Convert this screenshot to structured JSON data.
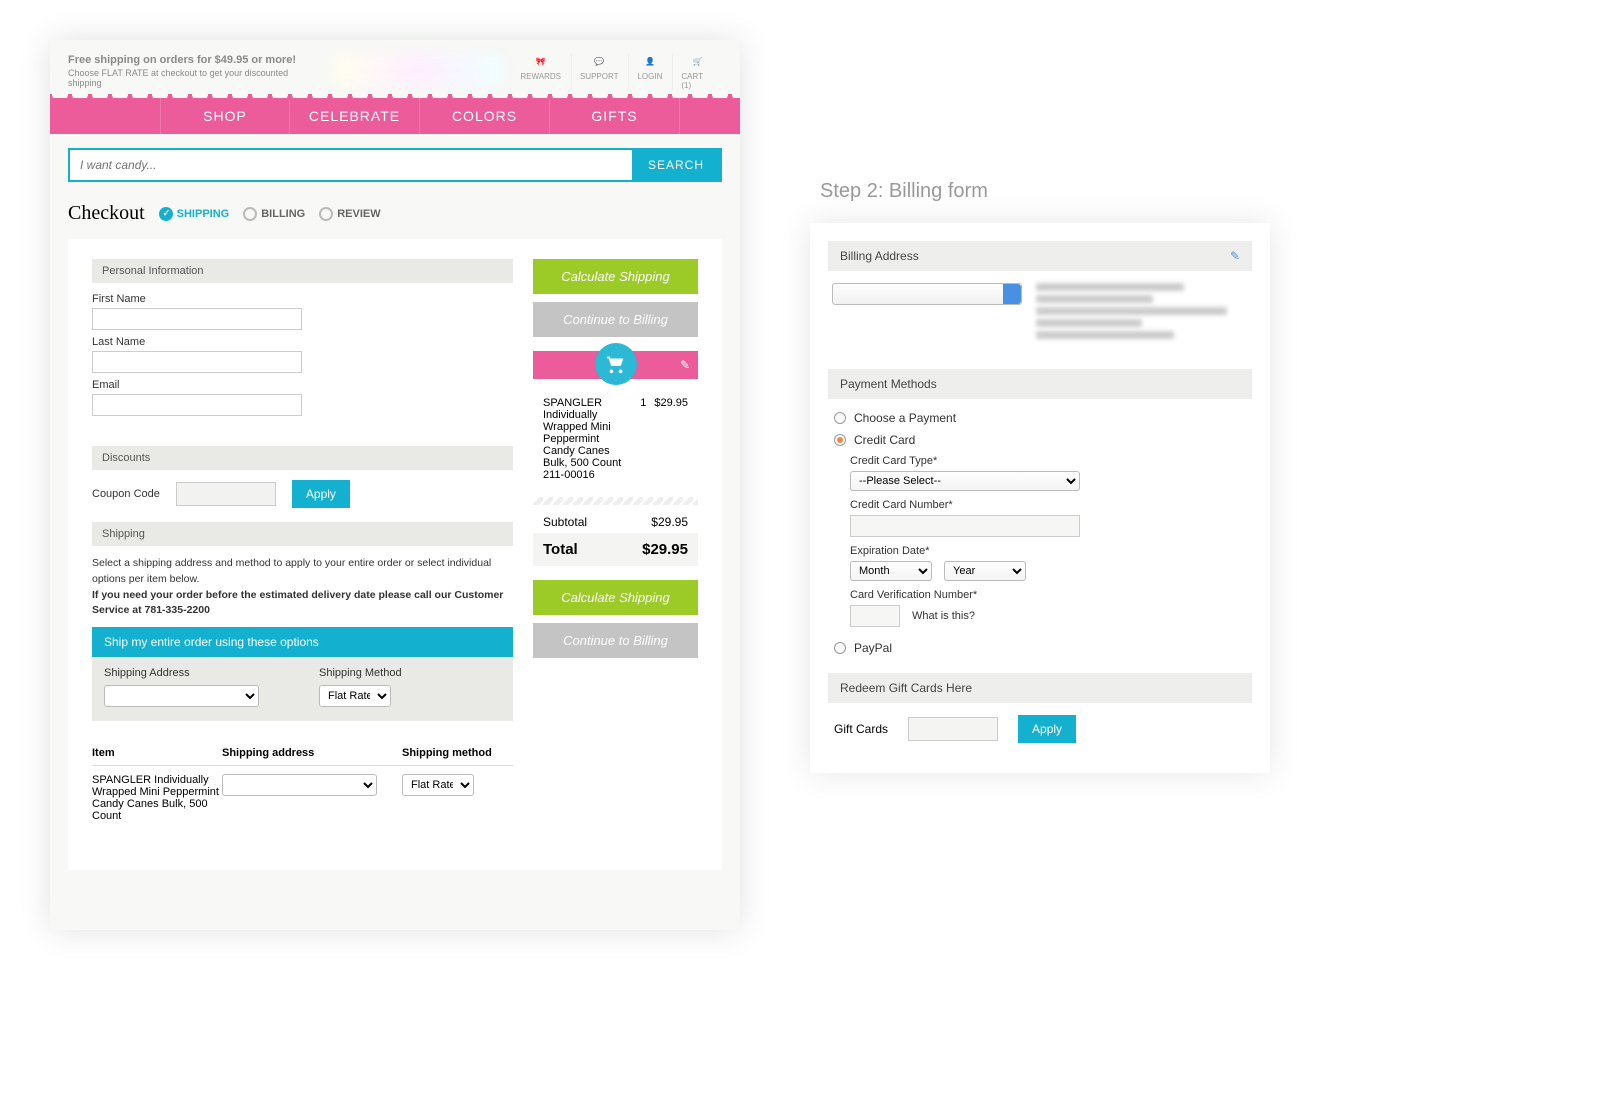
{
  "promo": {
    "title": "Free shipping on orders for $49.95 or more!",
    "sub": "Choose FLAT RATE at checkout to get your discounted shipping"
  },
  "topIcons": [
    {
      "label": "REWARDS"
    },
    {
      "label": "SUPPORT"
    },
    {
      "label": "LOGIN"
    },
    {
      "label": "CART (1)"
    }
  ],
  "nav": [
    "SHOP",
    "CELEBRATE",
    "COLORS",
    "GIFTS"
  ],
  "search": {
    "placeholder": "I want candy...",
    "button": "SEARCH"
  },
  "checkout": {
    "title": "Checkout",
    "steps": [
      "SHIPPING",
      "BILLING",
      "REVIEW"
    ]
  },
  "personal": {
    "header": "Personal Information",
    "first": "First Name",
    "last": "Last Name",
    "email": "Email"
  },
  "discounts": {
    "header": "Discounts",
    "coupon": "Coupon Code",
    "apply": "Apply"
  },
  "shipping": {
    "header": "Shipping",
    "text1": "Select a shipping address and method to apply to your entire order or select individual options per item below.",
    "text2": "If you need your order before the estimated delivery date please call our Customer Service at 781-335-2200",
    "bar": "Ship my entire order using these options",
    "addr": "Shipping Address",
    "method": "Shipping Method",
    "flat": "Flat Rate"
  },
  "itemTable": {
    "h1": "Item",
    "h2": "Shipping address",
    "h3": "Shipping method",
    "item": "SPANGLER Individually Wrapped Mini Peppermint Candy Canes Bulk, 500 Count",
    "flat": "Flat Rate"
  },
  "sidebar": {
    "calc": "Calculate Shipping",
    "cont": "Continue to Billing"
  },
  "cart": {
    "name": "SPANGLER Individually Wrapped Mini Peppermint Candy Canes Bulk, 500 Count",
    "sku": "211-00016",
    "qty": "1",
    "price": "$29.95",
    "subtotalL": "Subtotal",
    "subtotalV": "$29.95",
    "totalL": "Total",
    "totalV": "$29.95"
  },
  "step2": {
    "title": "Step 2: Billing form"
  },
  "billing": {
    "header": "Billing Address",
    "payHeader": "Payment Methods",
    "choose": "Choose a Payment",
    "cc": "Credit Card",
    "ccType": "Credit Card Type*",
    "please": "--Please Select--",
    "ccNum": "Credit Card Number*",
    "exp": "Expiration Date*",
    "month": "Month",
    "year": "Year",
    "cvv": "Card Verification Number*",
    "what": "What is this?",
    "paypal": "PayPal",
    "giftHeader": "Redeem Gift Cards Here",
    "giftLabel": "Gift Cards",
    "apply": "Apply"
  }
}
